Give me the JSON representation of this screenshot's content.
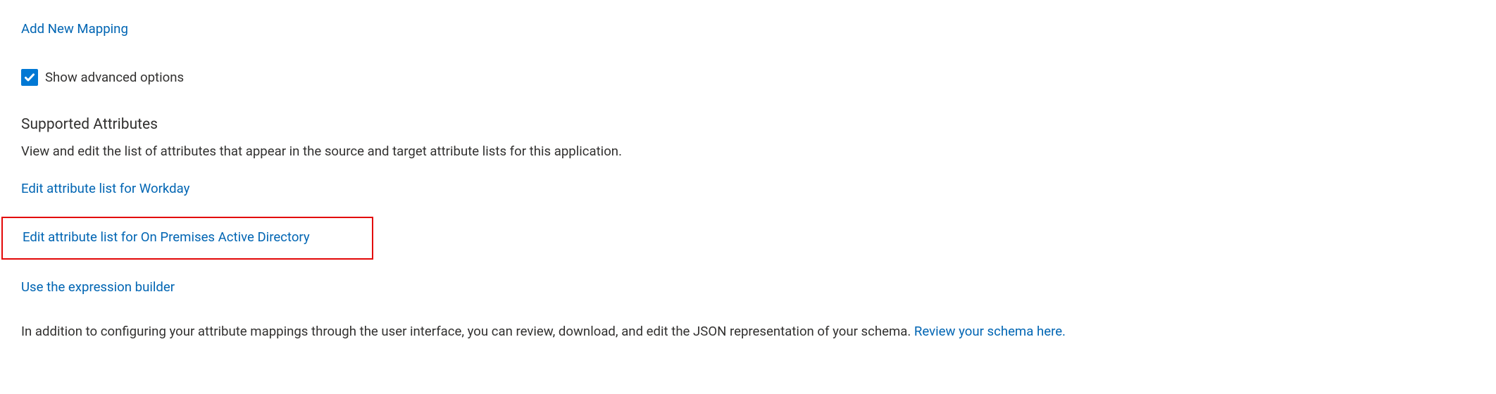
{
  "links": {
    "add_new_mapping": "Add New Mapping",
    "edit_workday": "Edit attribute list for Workday",
    "edit_on_prem_ad": "Edit attribute list for On Premises Active Directory",
    "use_expression_builder": "Use the expression builder",
    "review_schema": "Review your schema here."
  },
  "checkbox": {
    "show_advanced_label": "Show advanced options"
  },
  "section": {
    "supported_attributes_heading": "Supported Attributes",
    "supported_attributes_desc": "View and edit the list of attributes that appear in the source and target attribute lists for this application."
  },
  "footer": {
    "text_prefix": "In addition to configuring your attribute mappings through the user interface, you can review, download, and edit the JSON representation of your schema. "
  }
}
